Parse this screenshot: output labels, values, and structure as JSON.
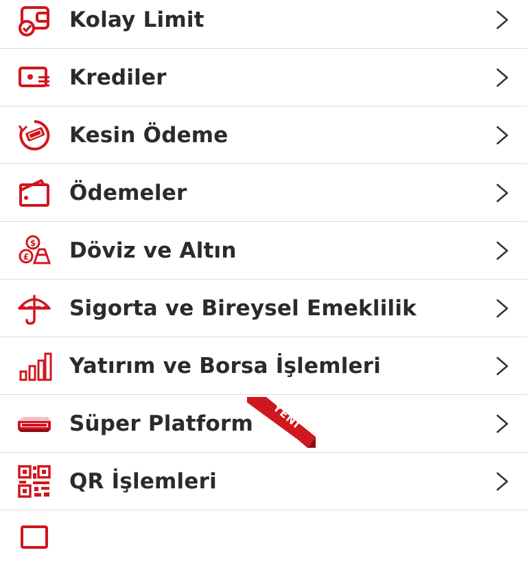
{
  "brand_color": "#d0161e",
  "menu": {
    "items": [
      {
        "label": "Kolay Limit",
        "icon": "wallet-check-icon"
      },
      {
        "label": "Krediler",
        "icon": "credit-card-money-icon"
      },
      {
        "label": "Kesin Ödeme",
        "icon": "exact-payment-icon"
      },
      {
        "label": "Ödemeler",
        "icon": "payments-wallet-icon"
      },
      {
        "label": "Döviz ve Altın",
        "icon": "currency-gold-icon"
      },
      {
        "label": "Sigorta ve Bireysel Emeklilik",
        "icon": "umbrella-icon"
      },
      {
        "label": "Yatırım ve Borsa İşlemleri",
        "icon": "bar-chart-icon"
      },
      {
        "label": "Süper Platform",
        "icon": "super-platform-logo-icon"
      },
      {
        "label": "QR İşlemleri",
        "icon": "qr-code-icon"
      }
    ],
    "new_badge": "YENİ"
  }
}
